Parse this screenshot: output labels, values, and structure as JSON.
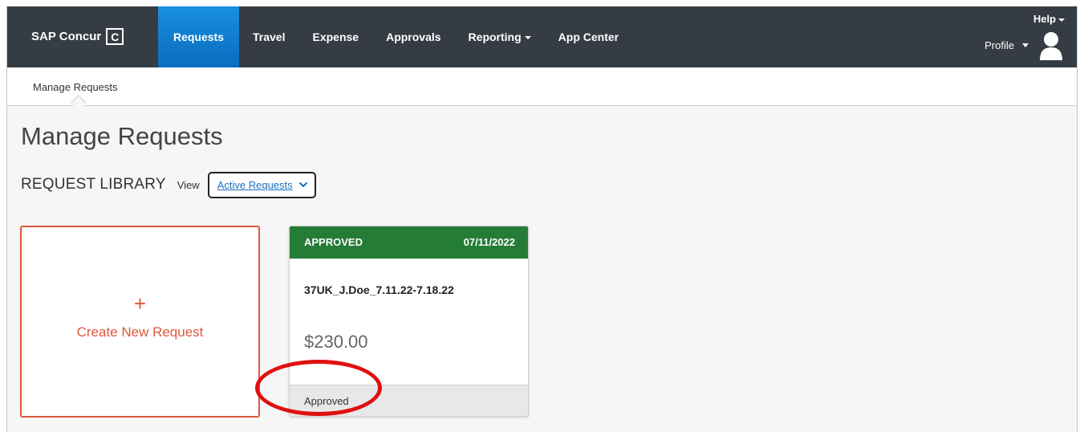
{
  "header": {
    "brand": "SAP Concur",
    "brand_logo_glyph": "C",
    "nav": [
      {
        "label": "Requests"
      },
      {
        "label": "Travel"
      },
      {
        "label": "Expense"
      },
      {
        "label": "Approvals"
      },
      {
        "label": "Reporting"
      },
      {
        "label": "App Center"
      }
    ],
    "help": "Help",
    "profile": "Profile",
    "active_color": "#1582d8",
    "bar_color": "#363c44"
  },
  "subnav": {
    "items": [
      {
        "label": "Manage Requests"
      }
    ]
  },
  "page": {
    "title": "Manage Requests",
    "library_label": "REQUEST LIBRARY",
    "view_label": "View",
    "view_value": "Active Requests"
  },
  "create_card": {
    "plus": "+",
    "label": "Create New Request",
    "accent_color": "#e0573c"
  },
  "request_cards": [
    {
      "status": "APPROVED",
      "date": "07/11/2022",
      "name": "37UK_J.Doe_7.11.22-7.18.22",
      "amount": "$230.00",
      "footer_status": "Approved",
      "status_color": "#247c36"
    }
  ],
  "annotation": {
    "highlight_color": "#e01010"
  }
}
